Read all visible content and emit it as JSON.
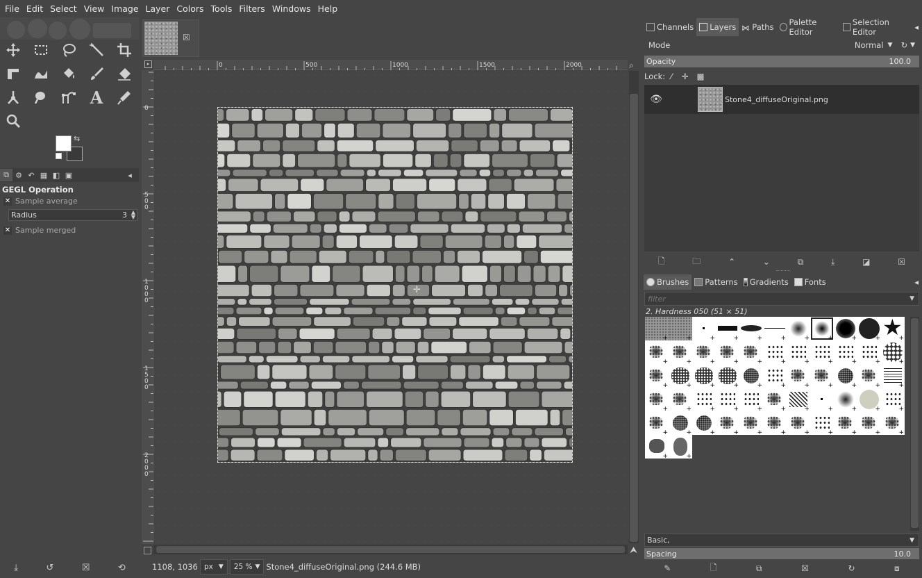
{
  "menu": [
    "File",
    "Edit",
    "Select",
    "View",
    "Image",
    "Layer",
    "Colors",
    "Tools",
    "Filters",
    "Windows",
    "Help"
  ],
  "tool_options": {
    "title": "GEGL Operation",
    "sample_average": "Sample average",
    "radius_label": "Radius",
    "radius_value": "3",
    "sample_merged": "Sample merged"
  },
  "ruler": {
    "h_ticks": [
      "0",
      "500",
      "1000",
      "1500",
      "2000"
    ],
    "v_ticks": [
      "0",
      "500",
      "1000",
      "1500",
      "2000"
    ]
  },
  "status": {
    "coords": "1108, 1036",
    "unit": "px",
    "zoom": "25 %",
    "file_info": "Stone4_diffuseOriginal.png (244.6 MB)"
  },
  "dock_top": {
    "tabs": [
      "Channels",
      "Layers",
      "Paths",
      "Palette Editor",
      "Selection Editor"
    ],
    "active_tab": "Layers",
    "mode_label": "Mode",
    "mode_value": "Normal",
    "opacity_label": "Opacity",
    "opacity_value": "100.0",
    "lock_label": "Lock:",
    "layer_name": "Stone4_diffuseOriginal.png"
  },
  "dock_bottom": {
    "tabs": [
      "Brushes",
      "Patterns",
      "Gradients",
      "Fonts"
    ],
    "active_tab": "Brushes",
    "filter_placeholder": "filter",
    "brush_name": "2. Hardness 050 (51 × 51)",
    "preset": "Basic,",
    "spacing_label": "Spacing",
    "spacing_value": "10.0"
  },
  "colors": {
    "foreground": "#ffffff",
    "background": "#3a3a3a"
  }
}
